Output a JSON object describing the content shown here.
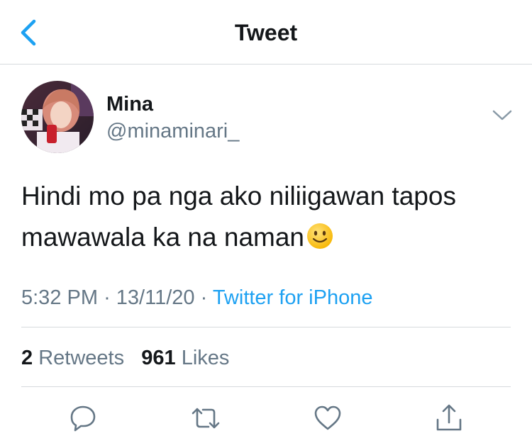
{
  "header": {
    "title": "Tweet",
    "back_icon": "chevron-left-icon"
  },
  "author": {
    "display_name": "Mina",
    "username": "@minaminari_"
  },
  "tweet": {
    "text_line1": "Hindi mo pa nga ako niliigawan tapos",
    "text_line2": "mawawala ka na naman",
    "emoji": "slightly-smiling-face-icon",
    "time": "5:32 PM",
    "separator": "·",
    "date": "13/11/20",
    "source": "Twitter for iPhone"
  },
  "stats": {
    "retweets_count": "2",
    "retweets_label": "Retweets",
    "likes_count": "961",
    "likes_label": "Likes"
  },
  "actions": [
    "reply-icon",
    "retweet-icon",
    "like-icon",
    "share-icon"
  ],
  "colors": {
    "accent": "#1da1f2",
    "text_primary": "#14171a",
    "text_secondary": "#657786",
    "divider": "#d6dadd"
  }
}
